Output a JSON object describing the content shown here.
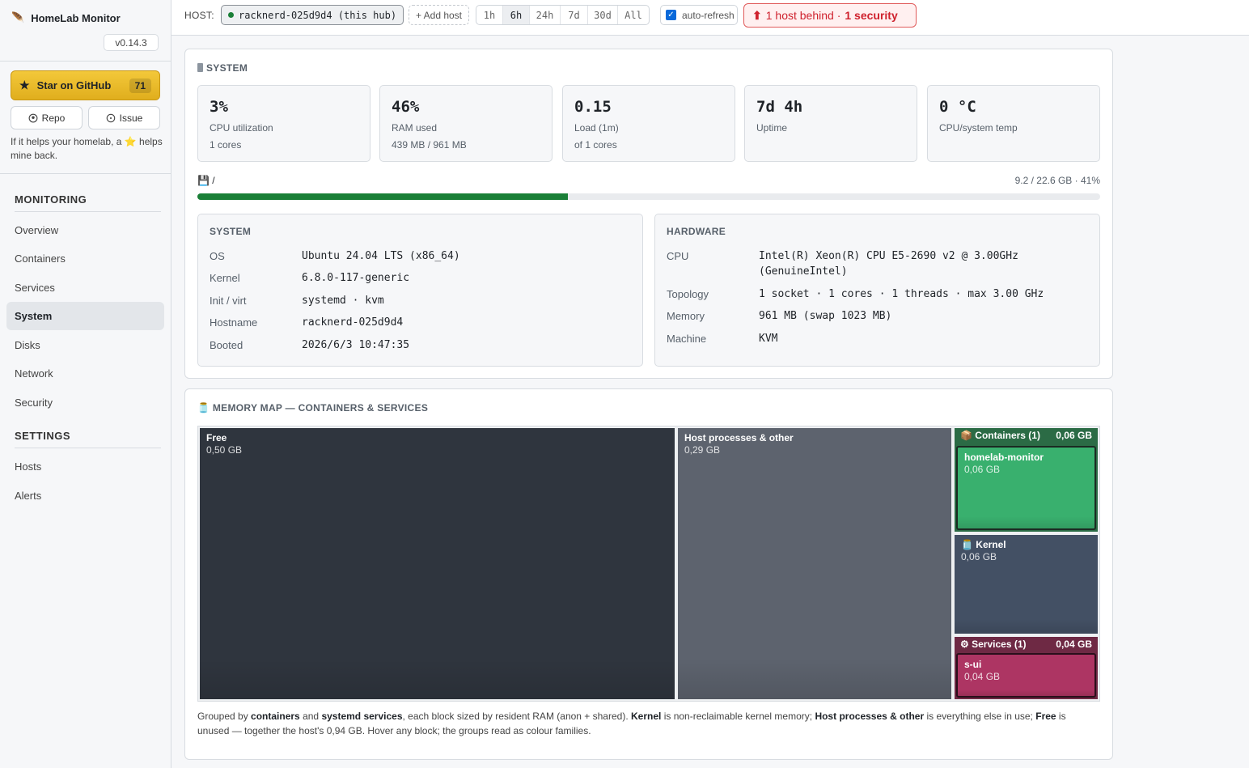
{
  "app": {
    "name": "HomeLab Monitor",
    "version": "v0.14.3"
  },
  "sidebar": {
    "star": {
      "label": "Star on GitHub",
      "count": "71"
    },
    "repo_label": "Repo",
    "issue_label": "Issue",
    "note": "If it helps your homelab, a ⭐ helps mine back.",
    "monitoring_title": "MONITORING",
    "monitoring_items": [
      "Overview",
      "Containers",
      "Services",
      "System",
      "Disks",
      "Network",
      "Security"
    ],
    "active_item": "System",
    "settings_title": "SETTINGS",
    "settings_items": [
      "Hosts",
      "Alerts"
    ]
  },
  "topbar": {
    "host_label": "HOST:",
    "host_value": "racknerd-025d9d4 (this hub)",
    "add_host": "+ Add host",
    "ranges": [
      "1h",
      "6h",
      "24h",
      "7d",
      "30d",
      "All"
    ],
    "active_range": "6h",
    "auto_refresh_label": "auto-refresh",
    "auto_refresh_checked": true,
    "alert": {
      "prefix": "1 host behind · ",
      "emph": "1 security"
    }
  },
  "system": {
    "title": "SYSTEM",
    "stats": [
      {
        "value": "3%",
        "label": "CPU utilization",
        "sub": "1 cores"
      },
      {
        "value": "46%",
        "label": "RAM used",
        "sub": "439 MB / 961 MB"
      },
      {
        "value": "0.15",
        "label": "Load (1m)",
        "sub": "of 1 cores"
      },
      {
        "value": "7d 4h",
        "label": "Uptime",
        "sub": ""
      },
      {
        "value": "0 °C",
        "label": "CPU/system temp",
        "sub": ""
      }
    ],
    "disk": {
      "mount": "/",
      "info": "9.2 / 22.6 GB · 41%",
      "percent": 41
    },
    "info_system": {
      "title": "SYSTEM",
      "rows": [
        {
          "k": "OS",
          "v": "Ubuntu 24.04 LTS (x86_64)"
        },
        {
          "k": "Kernel",
          "v": "6.8.0-117-generic"
        },
        {
          "k": "Init / virt",
          "v": "systemd · kvm"
        },
        {
          "k": "Hostname",
          "v": "racknerd-025d9d4"
        },
        {
          "k": "Booted",
          "v": "2026/6/3 10:47:35"
        }
      ]
    },
    "info_hardware": {
      "title": "HARDWARE",
      "rows": [
        {
          "k": "CPU",
          "v": "Intel(R) Xeon(R) CPU E5-2690 v2 @ 3.00GHz",
          "v2": "(GenuineIntel)"
        },
        {
          "k": "Topology",
          "v": "1 socket · 1 cores · 1 threads · max 3.00 GHz"
        },
        {
          "k": "Memory",
          "v": "961 MB (swap 1023 MB)"
        },
        {
          "k": "Machine",
          "v": "KVM"
        }
      ]
    }
  },
  "memory_map": {
    "title": "MEMORY MAP — CONTAINERS & SERVICES",
    "free": {
      "name": "Free",
      "size": "0,50 GB"
    },
    "host": {
      "name": "Host processes & other",
      "size": "0,29 GB"
    },
    "containers": {
      "name": "Containers (1)",
      "total": "0,06 GB",
      "item": {
        "name": "homelab-monitor",
        "size": "0,06 GB"
      }
    },
    "kernel": {
      "name": "Kernel",
      "size": "0,06 GB"
    },
    "services": {
      "name": "Services (1)",
      "total": "0,04 GB",
      "item": {
        "name": "s-ui",
        "size": "0,04 GB"
      }
    },
    "colors": {
      "free": "#2f353e",
      "host": "#5d636e",
      "containers": "#2b6b45",
      "container_item": "#39b06e",
      "kernel": "#435064",
      "services": "#6e2944",
      "service_item": "#ad3563"
    },
    "note_parts": [
      "Grouped by ",
      "containers",
      " and ",
      "systemd services",
      ", each block sized by resident RAM (anon + shared). ",
      "Kernel",
      " is non-reclaimable kernel memory; ",
      "Host processes & other",
      " is everything else in use; ",
      "Free",
      " is unused — together the host's 0,94 GB. Hover any block; the groups read as colour families."
    ]
  }
}
